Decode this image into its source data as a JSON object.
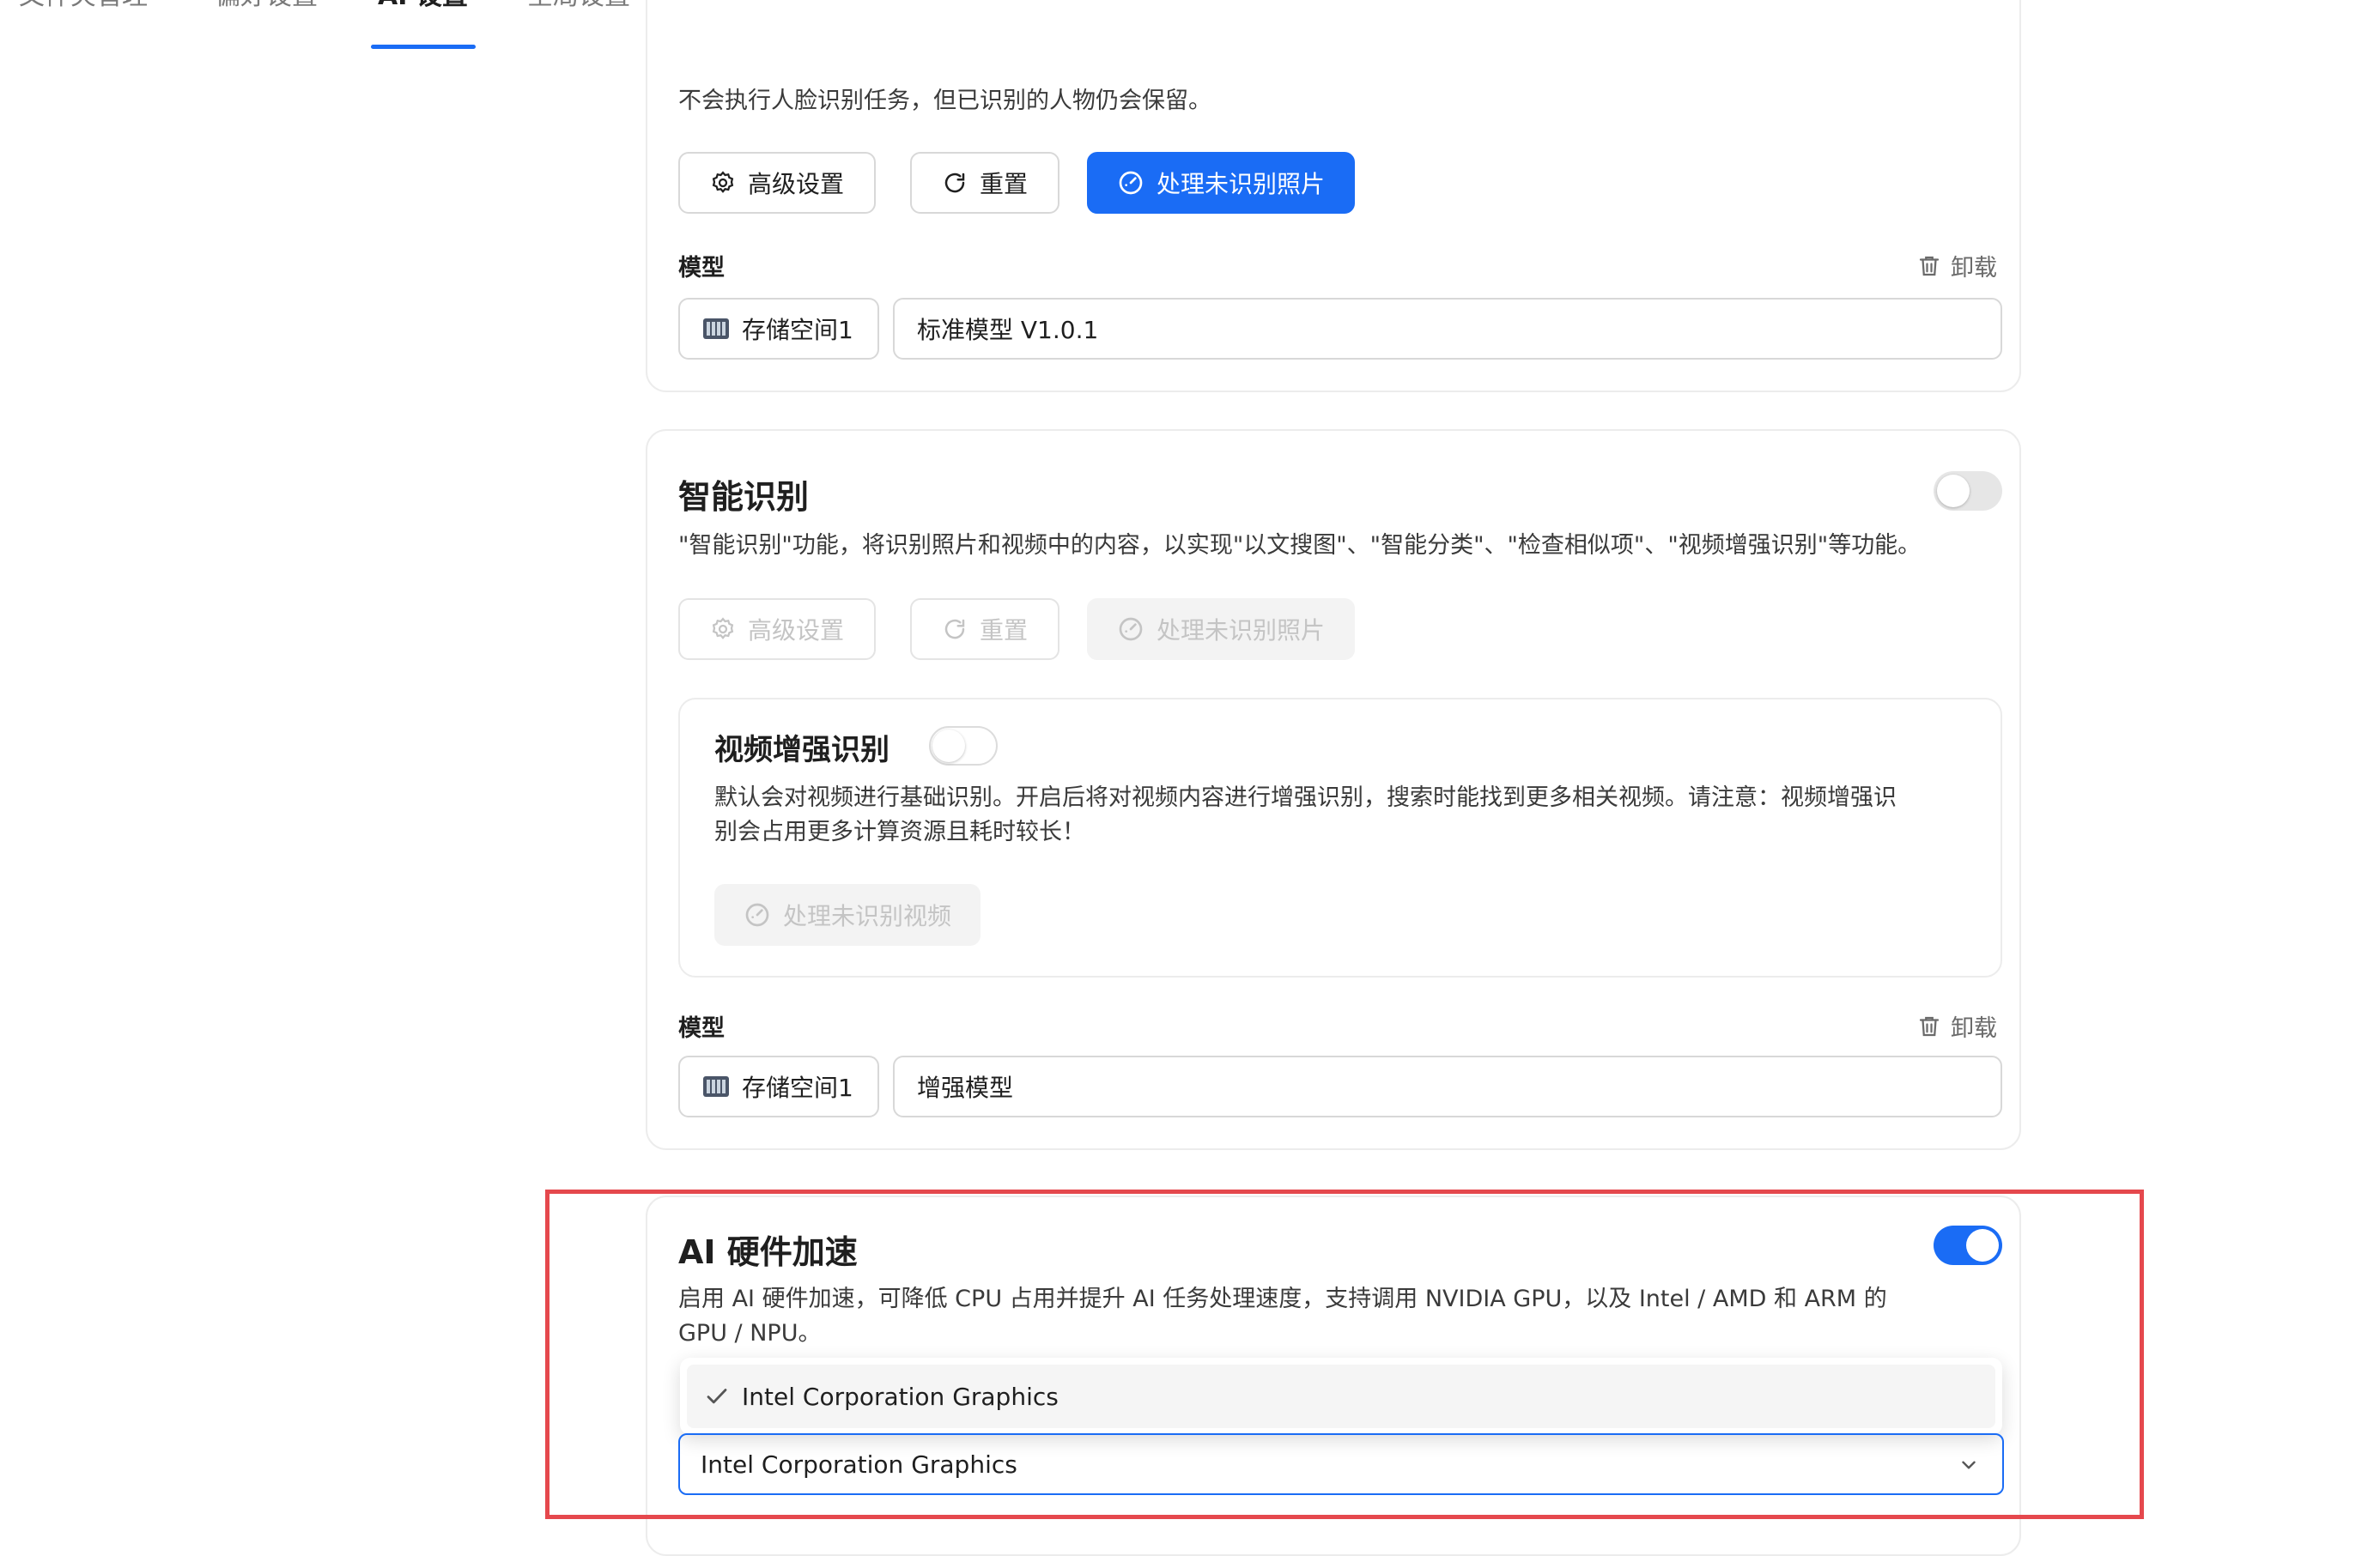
{
  "tabs": {
    "items": [
      {
        "label": "文件夹管理"
      },
      {
        "label": "偏好设置"
      },
      {
        "label": "AI 设置"
      },
      {
        "label": "全局设置"
      }
    ],
    "active": "AI 设置"
  },
  "face_section": {
    "desc": "不会执行人脸识别任务，但已识别的人物仍会保留。",
    "buttons": {
      "advanced": "高级设置",
      "reset": "重置",
      "process": "处理未识别照片"
    },
    "model_label": "模型",
    "unload": "卸载",
    "storage": "存储空间1",
    "model": "标准模型 V1.0.1"
  },
  "smart_section": {
    "title": "智能识别",
    "enabled": false,
    "desc": "\"智能识别\"功能，将识别照片和视频中的内容，以实现\"以文搜图\"、\"智能分类\"、\"检查相似项\"、\"视频增强识别\"等功能。",
    "buttons": {
      "advanced": "高级设置",
      "reset": "重置",
      "process": "处理未识别照片"
    },
    "video": {
      "title": "视频增强识别",
      "enabled": false,
      "desc_line1": "默认会对视频进行基础识别。开启后将对视频内容进行增强识别，搜索时能找到更多相关视频。请注意：视频增强识",
      "desc_line2": "别会占用更多计算资源且耗时较长！",
      "button": "处理未识别视频"
    },
    "model_label": "模型",
    "unload": "卸载",
    "storage": "存储空间1",
    "model": "增强模型"
  },
  "hw_section": {
    "title": "AI 硬件加速",
    "enabled": true,
    "desc_line1": "启用 AI 硬件加速，可降低 CPU 占用并提升 AI 任务处理速度，支持调用 NVIDIA GPU，以及 Intel / AMD 和 ARM 的",
    "desc_line2": "GPU / NPU。",
    "dropdown_option": "Intel Corporation Graphics",
    "selected": "Intel Corporation Graphics"
  },
  "colors": {
    "accent": "#1a6cf5",
    "highlight": "#e5484d"
  }
}
